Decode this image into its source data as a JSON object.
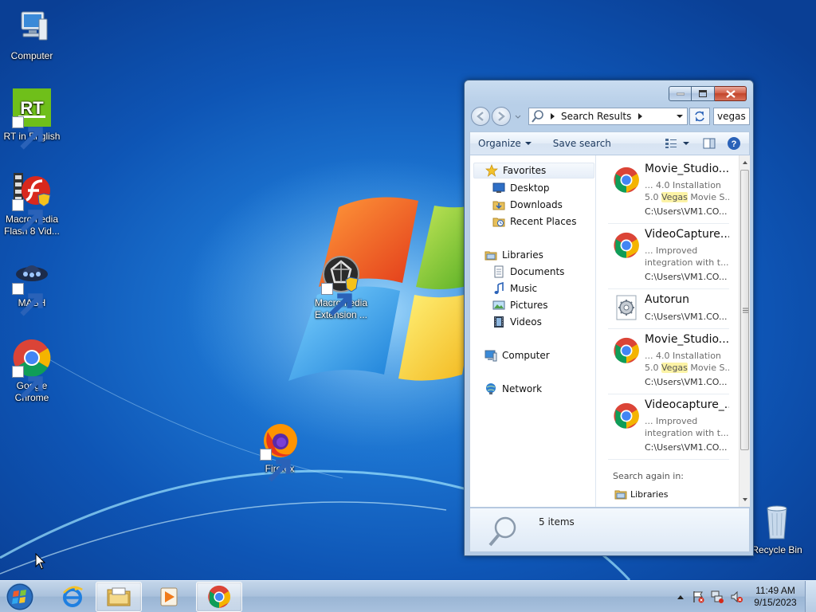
{
  "desktop": {
    "icons": [
      {
        "label": "Computer",
        "icon": "computer-icon"
      },
      {
        "label": "RT in English",
        "icon": "rt-news-icon"
      },
      {
        "label": "Macromedia Flash 8 Vid...",
        "icon": "flash-video-icon"
      },
      {
        "label": "MASH",
        "icon": "mash-icon"
      },
      {
        "label": "Google Chrome",
        "icon": "chrome-icon"
      },
      {
        "label": "Macromedia Extension ...",
        "icon": "extension-manager-icon"
      },
      {
        "label": "Firefox",
        "icon": "firefox-icon"
      },
      {
        "label": "Recycle Bin",
        "icon": "recycle-bin-icon"
      }
    ],
    "logo_text": "RT"
  },
  "explorer": {
    "address": {
      "segment": "Search Results"
    },
    "search_value": "vegas p",
    "commands": {
      "organize": "Organize",
      "save_search": "Save search"
    },
    "nav": {
      "favorites": "Favorites",
      "desktop": "Desktop",
      "downloads": "Downloads",
      "recent_places": "Recent Places",
      "libraries": "Libraries",
      "documents": "Documents",
      "music": "Music",
      "pictures": "Pictures",
      "videos": "Videos",
      "computer": "Computer",
      "network": "Network"
    },
    "results": [
      {
        "name": "Movie_Studio...",
        "snippet_a": "... 4.0 Installation",
        "snippet_b_pre": "5.0 ",
        "highlight": "Vegas",
        "snippet_b_post": " Movie S...",
        "path": "C:\\Users\\VM1.CO...",
        "icon": "chrome-icon"
      },
      {
        "name": "VideoCapture...",
        "snippet_a": "... Improved",
        "snippet_b_pre": "integration with t...",
        "highlight": "",
        "snippet_b_post": "",
        "path": "C:\\Users\\VM1.CO...",
        "icon": "chrome-icon"
      },
      {
        "name": "Autorun",
        "path": "C:\\Users\\VM1.CO...",
        "icon": "settings-file-icon"
      },
      {
        "name": "Movie_Studio...",
        "snippet_a": "... 4.0 Installation",
        "snippet_b_pre": "5.0 ",
        "highlight": "Vegas",
        "snippet_b_post": " Movie S...",
        "path": "C:\\Users\\VM1.CO...",
        "icon": "chrome-icon"
      },
      {
        "name": "Videocapture_...",
        "snippet_a": "... Improved",
        "snippet_b_pre": "integration with t...",
        "highlight": "",
        "snippet_b_post": "",
        "path": "C:\\Users\\VM1.CO...",
        "icon": "chrome-icon"
      }
    ],
    "search_again": {
      "label": "Search again in:",
      "libraries": "Libraries"
    },
    "details": {
      "count": "5 items"
    }
  },
  "taskbar": {
    "clock": {
      "time": "11:49 AM",
      "date": "9/15/2023"
    },
    "apps": [
      "internet-explorer-icon",
      "windows-explorer-icon",
      "media-player-icon",
      "chrome-icon"
    ]
  }
}
